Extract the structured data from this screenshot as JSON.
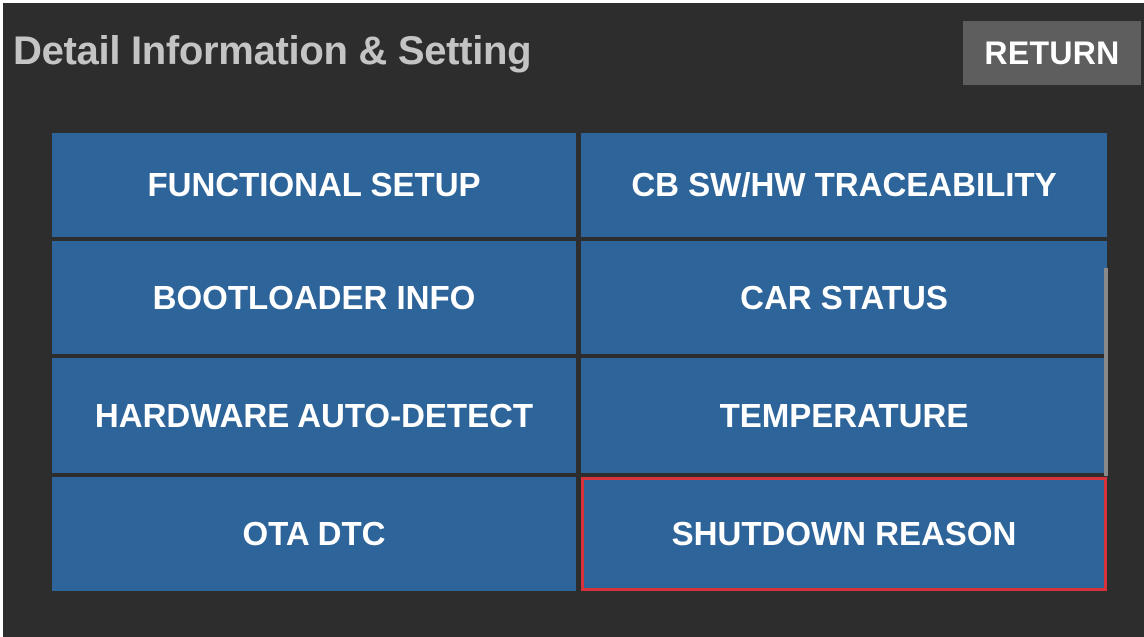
{
  "header": {
    "title": "Detail Information & Setting",
    "return_label": "RETURN"
  },
  "menu": {
    "items": [
      {
        "label": "FUNCTIONAL SETUP"
      },
      {
        "label": "CB SW/HW TRACEABILITY"
      },
      {
        "label": "BOOTLOADER INFO"
      },
      {
        "label": "CAR STATUS"
      },
      {
        "label": "HARDWARE AUTO-DETECT"
      },
      {
        "label": "TEMPERATURE"
      },
      {
        "label": "OTA DTC"
      },
      {
        "label": "SHUTDOWN REASON"
      }
    ],
    "selected_item": "SHUTDOWN REASON"
  },
  "colors": {
    "background": "#2d2d2d",
    "button": "#2d6499",
    "return_button": "#5e5e5e",
    "title_text": "#c4c4c4",
    "selection_outline": "#d8323a"
  }
}
